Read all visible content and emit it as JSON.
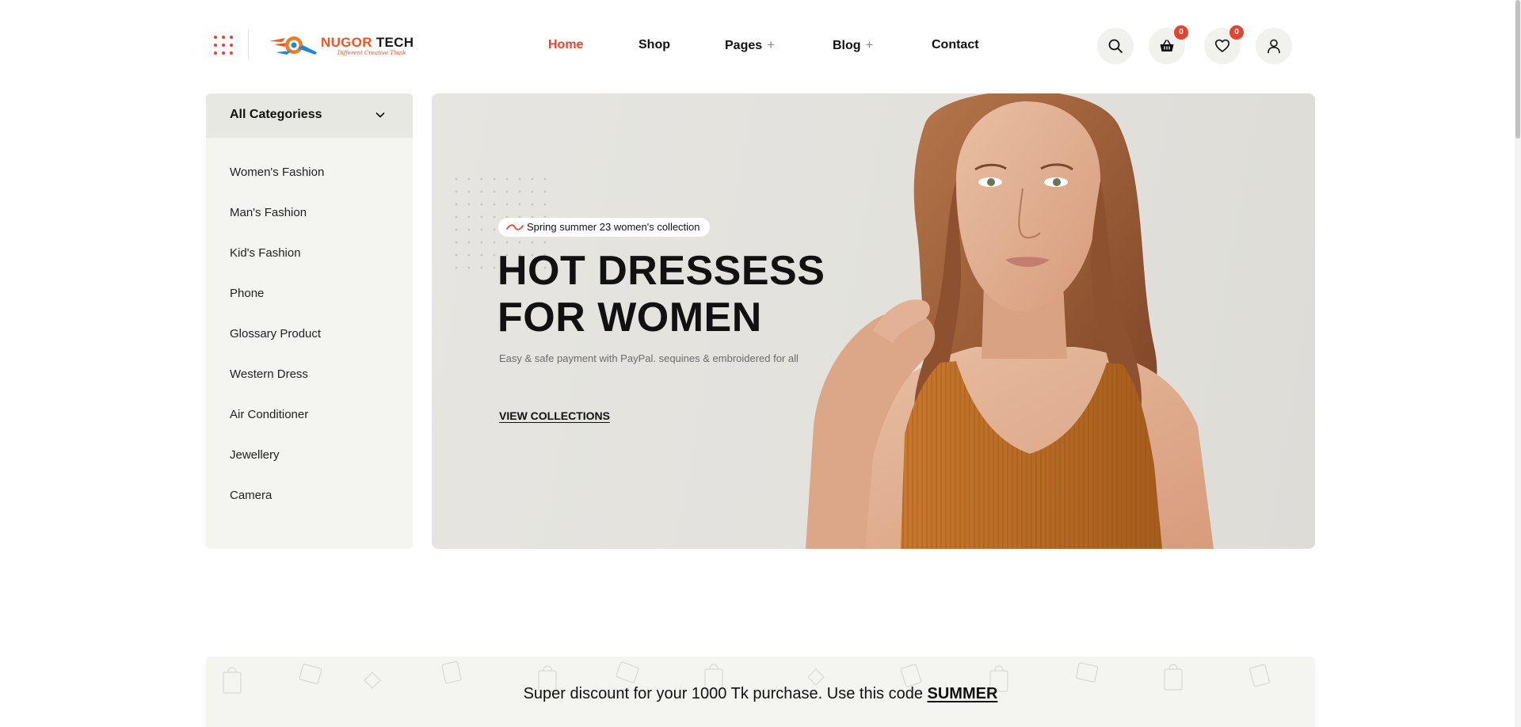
{
  "header": {
    "logo": {
      "brand_primary": "NUGOR",
      "brand_secondary": "TECH",
      "tagline": "Different Creative Think"
    },
    "nav": [
      {
        "label": "Home",
        "active": true,
        "has_submenu": false
      },
      {
        "label": "Shop",
        "active": false,
        "has_submenu": false
      },
      {
        "label": "Pages",
        "active": false,
        "has_submenu": true,
        "submenu_glyph": "+"
      },
      {
        "label": "Blog",
        "active": false,
        "has_submenu": true,
        "submenu_glyph": "+"
      },
      {
        "label": "Contact",
        "active": false,
        "has_submenu": false
      }
    ],
    "icons": {
      "cart_count": "0",
      "wishlist_count": "0"
    }
  },
  "sidebar": {
    "title": "All Categoriess",
    "items": [
      {
        "label": "Women's Fashion"
      },
      {
        "label": "Man's Fashion"
      },
      {
        "label": "Kid's Fashion"
      },
      {
        "label": "Phone"
      },
      {
        "label": "Glossary Product"
      },
      {
        "label": "Western Dress"
      },
      {
        "label": "Air Conditioner"
      },
      {
        "label": "Jewellery"
      },
      {
        "label": "Camera"
      }
    ]
  },
  "hero": {
    "tagline": "Spring summer 23 women's collection",
    "title_line1": "HOT DRESSESS",
    "title_line2": "FOR WOMEN",
    "subtitle": "Easy & safe payment with PayPal. sequines & embroidered for all",
    "cta": "VIEW COLLECTIONS"
  },
  "promo": {
    "text": "Super discount for your 1000 Tk purchase. Use this code",
    "code": "SUMMER"
  },
  "colors": {
    "accent": "#e8432f",
    "logo_orange": "#f0551f",
    "panel_bg": "#f4f4f0",
    "hero_bg": "#e4e3de",
    "dress": "#b86a22",
    "hair": "#9a5a32"
  }
}
